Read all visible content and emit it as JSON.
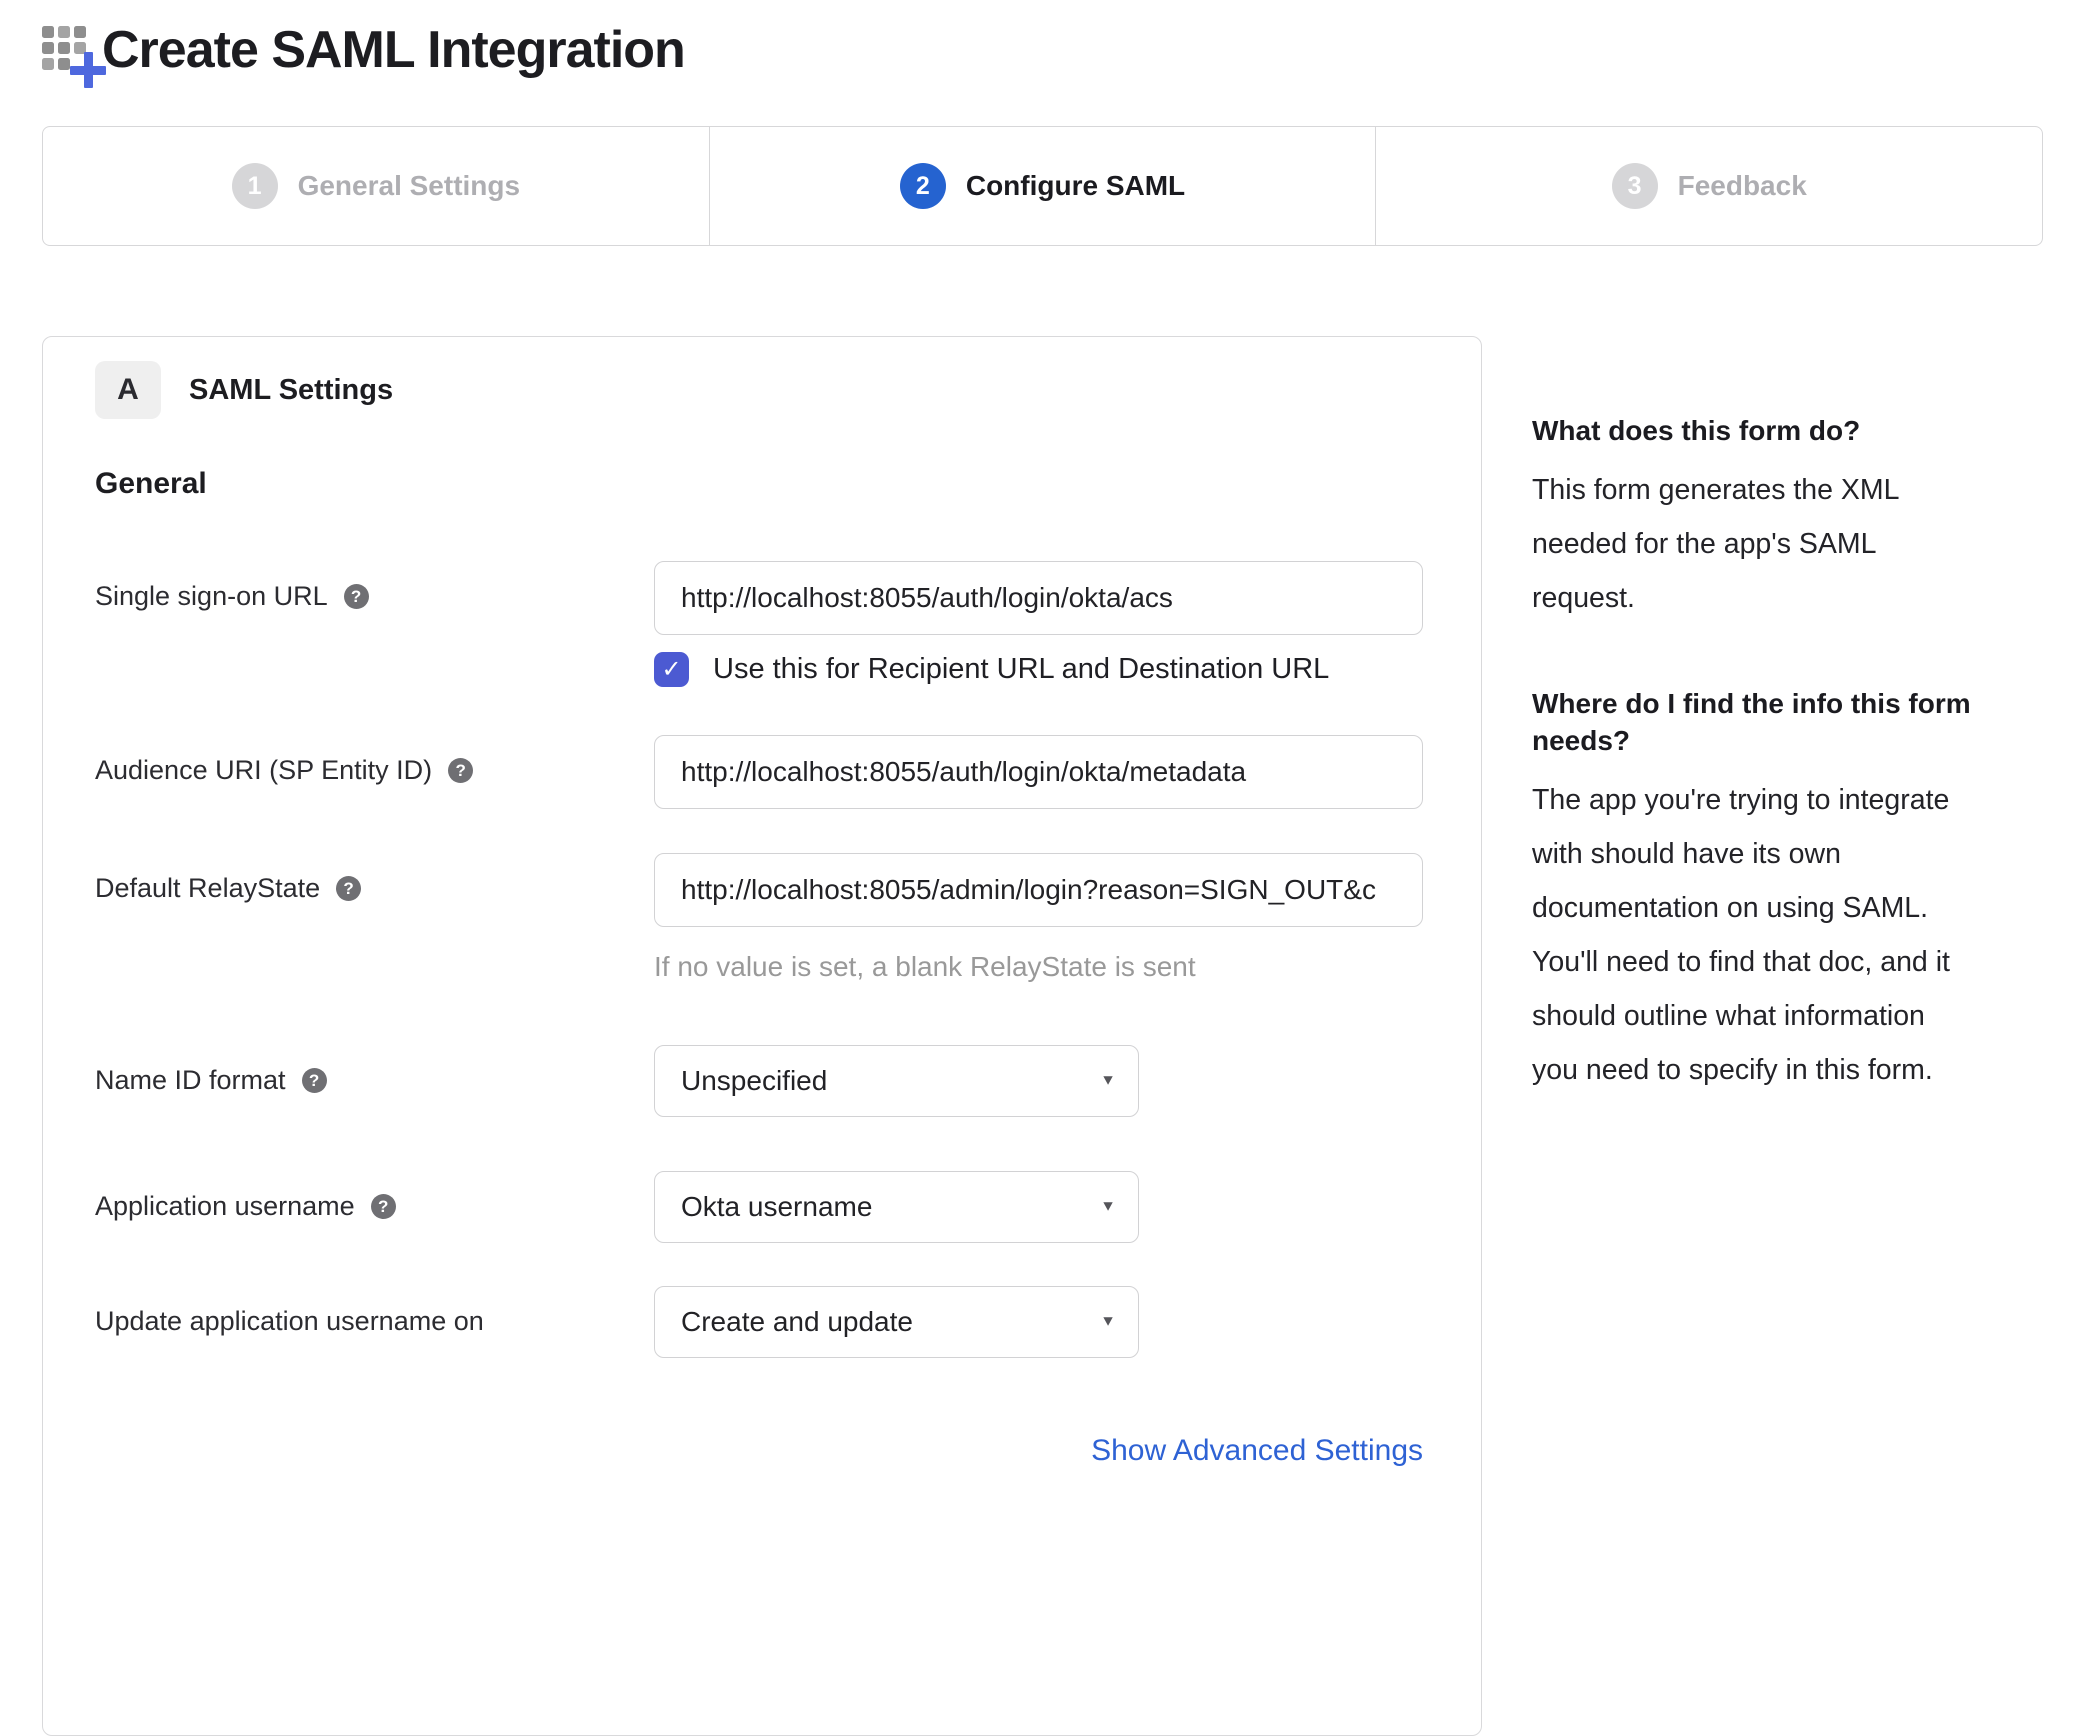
{
  "header": {
    "title": "Create SAML Integration"
  },
  "wizard": {
    "steps": [
      {
        "number": "1",
        "label": "General Settings",
        "state": "inactive"
      },
      {
        "number": "2",
        "label": "Configure SAML",
        "state": "active"
      },
      {
        "number": "3",
        "label": "Feedback",
        "state": "inactive"
      }
    ]
  },
  "panel": {
    "badge": "A",
    "title": "SAML Settings",
    "section_heading": "General",
    "fields": [
      {
        "label": "Single sign-on URL",
        "has_help": true,
        "type": "text",
        "value": "http://localhost:8055/auth/login/okta/acs",
        "checkbox": {
          "checked": true,
          "label": "Use this for Recipient URL and Destination URL"
        }
      },
      {
        "label": "Audience URI (SP Entity ID)",
        "has_help": true,
        "type": "text",
        "value": "http://localhost:8055/auth/login/okta/metadata"
      },
      {
        "label": "Default RelayState",
        "has_help": true,
        "type": "text",
        "value": "http://localhost:8055/admin/login?reason=SIGN_OUT&c",
        "helper": "If no value is set, a blank RelayState is sent"
      },
      {
        "label": "Name ID format",
        "has_help": true,
        "type": "select",
        "value": "Unspecified"
      },
      {
        "label": "Application username",
        "has_help": true,
        "type": "select",
        "value": "Okta username"
      },
      {
        "label": "Update application username on",
        "has_help": false,
        "type": "select",
        "value": "Create and update"
      }
    ],
    "advanced_link": "Show Advanced Settings"
  },
  "sidebar": {
    "sections": [
      {
        "heading": "What does this form do?",
        "body": "This form generates the XML needed for the app's SAML request."
      },
      {
        "heading": "Where do I find the info this form needs?",
        "body": "The app you're trying to integrate with should have its own documentation on using SAML. You'll need to find that doc, and it should outline what information you need to specify in this form."
      }
    ]
  },
  "icons": {
    "help": "?",
    "check": "✓",
    "dropdown_arrow": "▼"
  },
  "colors": {
    "active_step_blue": "#2563d0",
    "checkbox_indigo": "#4c5ad2",
    "link_blue": "#2e62d4",
    "plus_icon_blue": "#4e68de",
    "inactive_step_gray": "#d6d6d8",
    "border_gray": "#d7d7d9",
    "helper_gray": "#999999"
  }
}
